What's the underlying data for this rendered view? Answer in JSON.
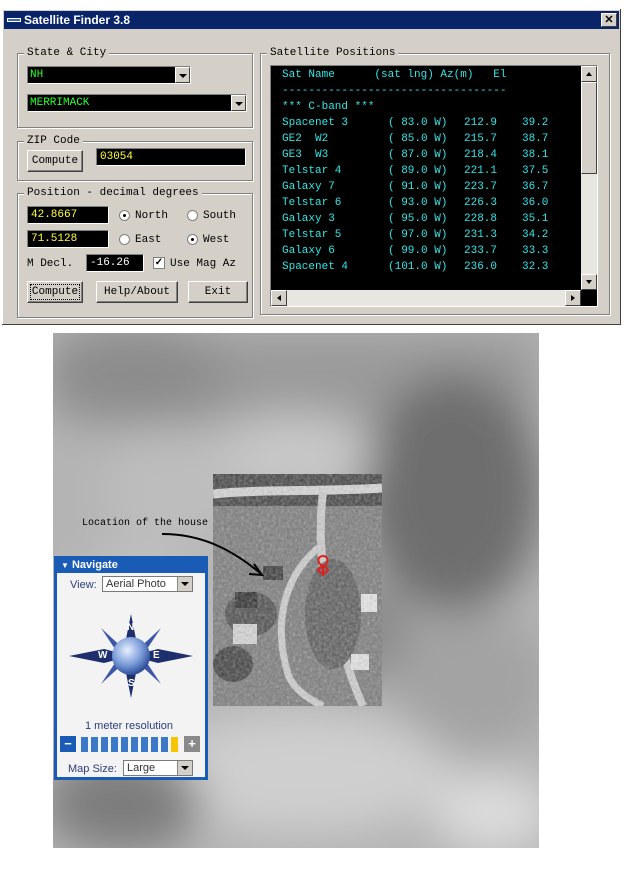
{
  "window": {
    "title": "Satellite Finder 3.8",
    "close_label": "✕"
  },
  "state_city": {
    "group_label": "State & City",
    "state": "NH",
    "city": "MERRIMACK"
  },
  "zip": {
    "group_label": "ZIP Code",
    "compute_label": "Compute",
    "value": "03054"
  },
  "position": {
    "group_label": "Position - decimal degrees",
    "lat": "42.8667",
    "lon": "71.5128",
    "north_label": "North",
    "south_label": "South",
    "east_label": "East",
    "west_label": "West",
    "lat_dir": "North",
    "lon_dir": "West",
    "mdecl_label": "M Decl.",
    "mdecl_value": "-16.26",
    "use_mag_label": "Use Mag Az",
    "use_mag_checked": true
  },
  "buttons": {
    "compute": "Compute",
    "help": "Help/About",
    "exit": "Exit"
  },
  "sat_positions": {
    "group_label": "Satellite Positions",
    "header": "Sat Name      (sat lng) Az(m)   El",
    "divider": "----------------------------------",
    "band": "*** C-band ***",
    "rows": [
      {
        "name": "Spacenet 3",
        "lng": "( 83.0 W)",
        "az": "212.9",
        "el": "39.2"
      },
      {
        "name": "GE2  W2",
        "lng": "( 85.0 W)",
        "az": "215.7",
        "el": "38.7"
      },
      {
        "name": "GE3  W3",
        "lng": "( 87.0 W)",
        "az": "218.4",
        "el": "38.1"
      },
      {
        "name": "Telstar 4",
        "lng": "( 89.0 W)",
        "az": "221.1",
        "el": "37.5"
      },
      {
        "name": "Galaxy 7",
        "lng": "( 91.0 W)",
        "az": "223.7",
        "el": "36.7"
      },
      {
        "name": "Telstar 6",
        "lng": "( 93.0 W)",
        "az": "226.3",
        "el": "36.0"
      },
      {
        "name": "Galaxy 3",
        "lng": "( 95.0 W)",
        "az": "228.8",
        "el": "35.1"
      },
      {
        "name": "Telstar 5",
        "lng": "( 97.0 W)",
        "az": "231.3",
        "el": "34.2"
      },
      {
        "name": "Galaxy 6",
        "lng": "( 99.0 W)",
        "az": "233.7",
        "el": "33.3"
      },
      {
        "name": "Spacenet 4",
        "lng": "(101.0 W)",
        "az": "236.0",
        "el": "32.3"
      }
    ]
  },
  "map": {
    "annotation": "Location of the house",
    "navigate": {
      "title": "Navigate",
      "view_label": "View:",
      "view_value": "Aerial Photo",
      "compass": {
        "n": "N",
        "s": "S",
        "e": "E",
        "w": "W"
      },
      "resolution": "1 meter resolution",
      "zoom_minus": "−",
      "zoom_plus": "+",
      "zoom_level": 10,
      "zoom_steps": 10,
      "map_size_label": "Map Size:",
      "map_size_value": "Large"
    }
  },
  "colors": {
    "titlebar": "#0a246a",
    "listing_text": "#33e6e6",
    "field_green": "#2bff2b",
    "field_yellow": "#ffff40",
    "nav_blue": "#1a5bb5",
    "marker": "#e02020"
  }
}
